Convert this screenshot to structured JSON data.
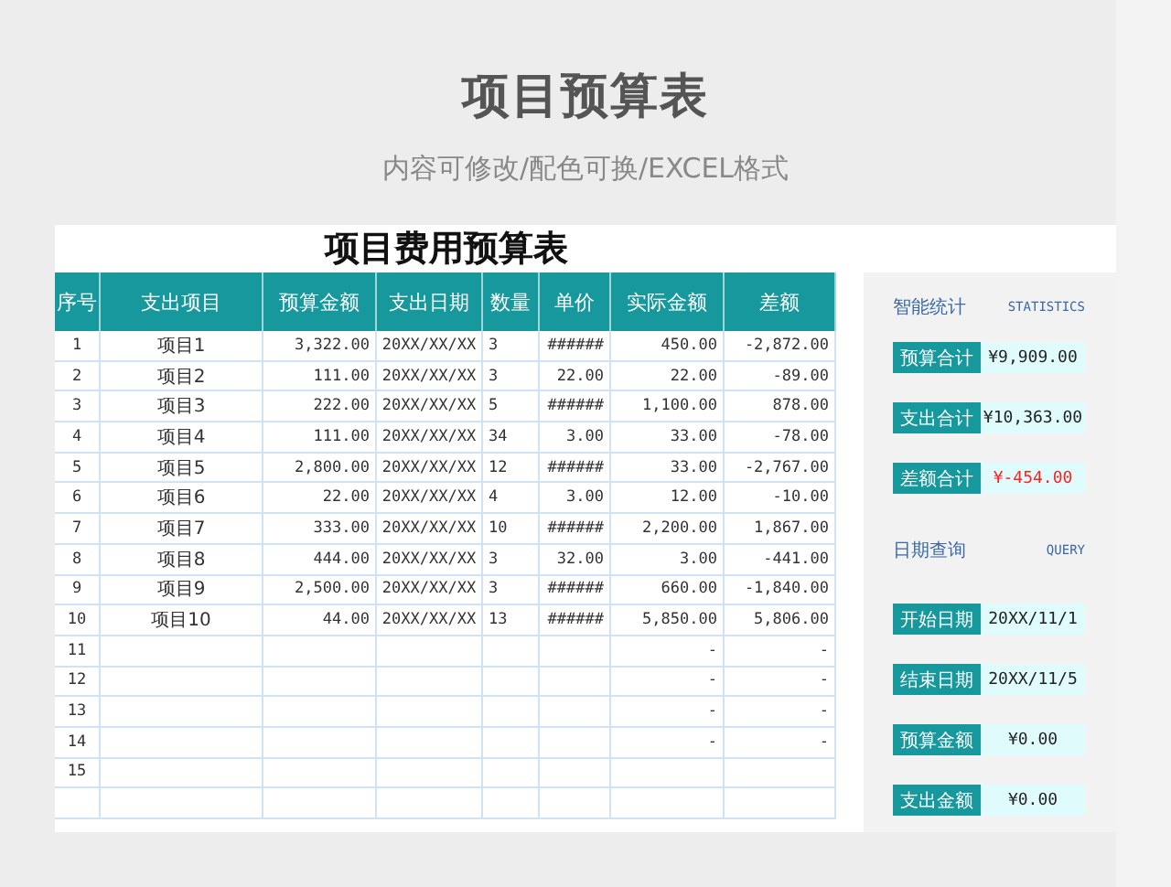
{
  "title": "项目预算表",
  "subtitle": "内容可修改/配色可换/EXCEL格式",
  "sheet": {
    "title": "项目费用预算表",
    "table": {
      "columns": [
        "序号",
        "支出项目",
        "预算金额",
        "支出日期",
        "数量",
        "单价",
        "实际金额",
        "差额"
      ],
      "rows": [
        [
          "1",
          "项目1",
          "3,322.00",
          "20XX/XX/XX",
          "3",
          "######",
          "450.00",
          "-2,872.00"
        ],
        [
          "2",
          "项目2",
          "111.00",
          "20XX/XX/XX",
          "3",
          "22.00",
          "22.00",
          "-89.00"
        ],
        [
          "3",
          "项目3",
          "222.00",
          "20XX/XX/XX",
          "5",
          "######",
          "1,100.00",
          "878.00"
        ],
        [
          "4",
          "项目4",
          "111.00",
          "20XX/XX/XX",
          "34",
          "3.00",
          "33.00",
          "-78.00"
        ],
        [
          "5",
          "项目5",
          "2,800.00",
          "20XX/XX/XX",
          "12",
          "######",
          "33.00",
          "-2,767.00"
        ],
        [
          "6",
          "项目6",
          "22.00",
          "20XX/XX/XX",
          "4",
          "3.00",
          "12.00",
          "-10.00"
        ],
        [
          "7",
          "项目7",
          "333.00",
          "20XX/XX/XX",
          "10",
          "######",
          "2,200.00",
          "1,867.00"
        ],
        [
          "8",
          "项目8",
          "444.00",
          "20XX/XX/XX",
          "3",
          "32.00",
          "3.00",
          "-441.00"
        ],
        [
          "9",
          "项目9",
          "2,500.00",
          "20XX/XX/XX",
          "3",
          "######",
          "660.00",
          "-1,840.00"
        ],
        [
          "10",
          "项目10",
          "44.00",
          "20XX/XX/XX",
          "13",
          "######",
          "5,850.00",
          "5,806.00"
        ],
        [
          "11",
          null,
          null,
          null,
          null,
          null,
          "-",
          "-"
        ],
        [
          "12",
          null,
          null,
          null,
          null,
          null,
          "-",
          "-"
        ],
        [
          "13",
          null,
          null,
          null,
          null,
          null,
          "-",
          "-"
        ],
        [
          "14",
          null,
          null,
          null,
          null,
          null,
          "-",
          "-"
        ],
        [
          "15",
          null,
          null,
          null,
          null,
          null,
          null,
          null
        ]
      ]
    },
    "panel": [
      {
        "title": "智能统计",
        "english": "STATISTICS",
        "items": [
          {
            "label": "预算合计",
            "value": "¥9,909.00",
            "color": "#222222"
          },
          {
            "label": "支出合计",
            "value": "¥10,363.00",
            "color": "#222222"
          },
          {
            "label": "差额合计",
            "value": "¥-454.00",
            "color": "#ff2020"
          }
        ]
      },
      {
        "title": "日期查询",
        "english": "QUERY",
        "items": [
          {
            "label": "开始日期",
            "value": "20XX/11/1",
            "color": "#222222"
          },
          {
            "label": "结束日期",
            "value": "20XX/11/5",
            "color": "#222222"
          },
          {
            "label": "预算金额",
            "value": "¥0.00",
            "color": "#222222"
          },
          {
            "label": "支出金额",
            "value": "¥0.00",
            "color": "#222222"
          }
        ]
      }
    ]
  }
}
